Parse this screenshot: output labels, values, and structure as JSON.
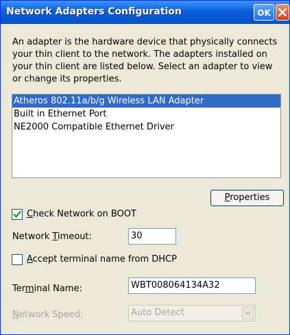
{
  "window": {
    "title": "Network Adapters Configuration",
    "ok_label": "OK"
  },
  "description": "An adapter is the hardware device that physically connects your thin client to the network.  The adapters installed on your thin client are listed below.  Select an adapter to view or change its properties.",
  "adapters": [
    {
      "label": "Atheros 802.11a/b/g Wireless LAN Adapter",
      "selected": true
    },
    {
      "label": "Built in Ethernet Port",
      "selected": false
    },
    {
      "label": "NE2000 Compatible Ethernet Driver",
      "selected": false
    }
  ],
  "properties_button": {
    "pre": "",
    "mn": "P",
    "post": "roperties"
  },
  "check_network": {
    "checked": true,
    "pre": "",
    "mn": "C",
    "post": "heck Network on BOOT"
  },
  "network_timeout": {
    "label_pre": "Network ",
    "label_mn": "T",
    "label_post": "imeout:",
    "value": "30"
  },
  "accept_terminal": {
    "checked": false,
    "pre": "",
    "mn": "A",
    "post": "ccept terminal name from DHCP"
  },
  "terminal_name": {
    "label_pre": "Ter",
    "label_mn": "m",
    "label_post": "inal Name:",
    "value": "WBT008064134A32"
  },
  "network_speed": {
    "label_pre": "",
    "label_mn": "N",
    "label_post": "etwork Speed:",
    "value": "Auto Detect"
  },
  "colors": {
    "titlebar": "#0a5fd8",
    "selection": "#316ac5",
    "background": "#ece9d8",
    "check_green": "#21a121"
  },
  "icons": {
    "close": "close-icon",
    "check": "checkmark-icon",
    "dropdown": "chevron-down-icon"
  }
}
